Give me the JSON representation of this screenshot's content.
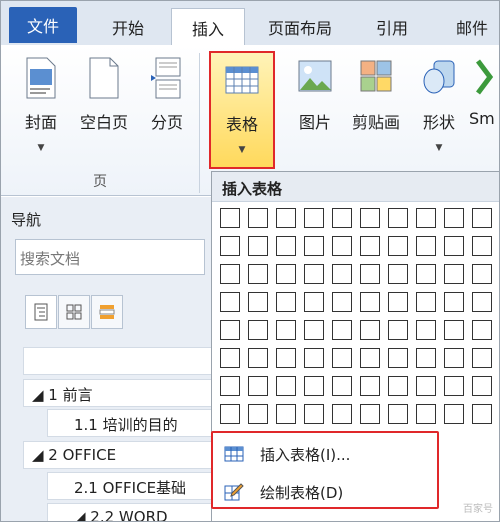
{
  "tabs": [
    "文件",
    "开始",
    "插入",
    "页面布局",
    "引用",
    "邮件"
  ],
  "ribbon": {
    "cover": "封面",
    "blank": "空白页",
    "pagebreak": "分页",
    "page_group": "页",
    "table": "表格",
    "picture": "图片",
    "clipart": "剪贴画",
    "shapes": "形状",
    "smartart": "Sm"
  },
  "nav": {
    "title": "导航",
    "search_placeholder": "搜索文档",
    "tree": [
      {
        "label": "◢ 1 前言",
        "level": 1
      },
      {
        "label": "1.1 培训的目的",
        "level": 2
      },
      {
        "label": "◢ 2 OFFICE",
        "level": 1
      },
      {
        "label": "2.1 OFFICE基础",
        "level": 2
      },
      {
        "label": "◢ 2.2 WORD",
        "level": 2
      }
    ]
  },
  "dropdown": {
    "title": "插入表格",
    "insert_table": "插入表格(I)...",
    "draw_table": "绘制表格(D)"
  },
  "colors": {
    "file_tab": "#2a62b7",
    "highlight_border": "#e0282a"
  },
  "watermark": "百家号"
}
